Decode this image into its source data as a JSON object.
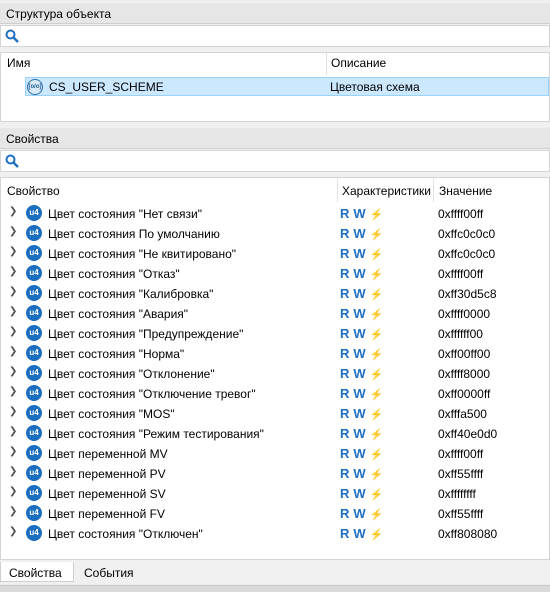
{
  "structure": {
    "title": "Структура объекта",
    "search_placeholder": "",
    "col_name": "Имя",
    "col_description": "Описание",
    "item": {
      "icon": "object-icon",
      "icon_text": "[o/o]",
      "name": "CS_USER_SCHEME",
      "description": "Цветовая схема"
    }
  },
  "properties": {
    "title": "Свойства",
    "search_placeholder": "",
    "col_property": "Свойство",
    "col_characteristics": "Характеристики",
    "col_value": "Значение",
    "badge_text": "u4",
    "flag_r": "R",
    "flag_w": "W",
    "flag_bolt": "⚡",
    "rows": [
      {
        "name": "Цвет состояния \"Нет связи\"",
        "value": "0xffff00ff"
      },
      {
        "name": "Цвет состояния По умолчанию",
        "value": "0xffc0c0c0"
      },
      {
        "name": "Цвет состояния \"Не квитировано\"",
        "value": "0xffc0c0c0"
      },
      {
        "name": "Цвет состояния \"Отказ\"",
        "value": "0xffff00ff"
      },
      {
        "name": "Цвет состояния \"Калибровка\"",
        "value": "0xff30d5c8"
      },
      {
        "name": "Цвет состояния \"Авария\"",
        "value": "0xffff0000"
      },
      {
        "name": "Цвет состояния \"Предупреждение\"",
        "value": "0xffffff00"
      },
      {
        "name": "Цвет состояния \"Норма\"",
        "value": "0xff00ff00"
      },
      {
        "name": "Цвет состояния \"Отклонение\"",
        "value": "0xffff8000"
      },
      {
        "name": "Цвет состояния \"Отключение тревог\"",
        "value": "0xff0000ff"
      },
      {
        "name": "Цвет состояния \"MOS\"",
        "value": "0xfffa500"
      },
      {
        "name": "Цвет состояния \"Режим тестирования\"",
        "value": "0xff40e0d0"
      },
      {
        "name": "Цвет переменной MV",
        "value": "0xffff00ff"
      },
      {
        "name": "Цвет переменной PV",
        "value": "0xff55ffff"
      },
      {
        "name": "Цвет переменной SV",
        "value": "0xffffffff"
      },
      {
        "name": "Цвет переменной FV",
        "value": "0xff55ffff"
      },
      {
        "name": "Цвет состояния \"Отключен\"",
        "value": "0xff808080"
      }
    ]
  },
  "tabs": [
    {
      "label": "Свойства",
      "active": true
    },
    {
      "label": "События",
      "active": false
    }
  ],
  "colors": {
    "accent": "#1f6fc2",
    "selection": "#cce8ff"
  }
}
